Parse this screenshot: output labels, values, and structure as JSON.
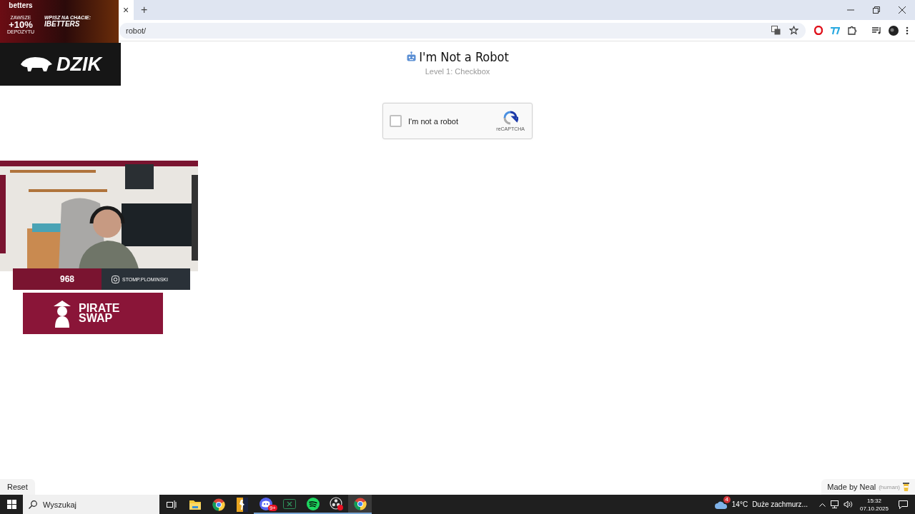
{
  "browser": {
    "tab_close": "×",
    "new_tab": "+",
    "address": "robot/"
  },
  "page": {
    "title": "I'm Not a Robot",
    "subtitle": "Level 1: Checkbox",
    "captcha": {
      "label": "I'm not a robot",
      "checked": false,
      "brand": "reCAPTCHA"
    },
    "reset": "Reset",
    "credit": {
      "text": "Made by Neal",
      "note": "(human)"
    }
  },
  "overlay": {
    "ad": {
      "brand": "betters",
      "promo_top": "ZAWSZE",
      "promo": "+10%",
      "promo_bottom": "DEPOZYTU",
      "prompt": "WPISZ NA CHACIE:",
      "code": "IBETTERS"
    },
    "sponsor": "DZIK",
    "channel_badge": "968",
    "handle": "STOMP.PLOMINSKI",
    "partner": "PIRATE SWAP"
  },
  "taskbar": {
    "search_placeholder": "Wyszukaj",
    "apps": [
      {
        "kind": "folder",
        "running": false,
        "selected": false
      },
      {
        "kind": "chrome",
        "running": false,
        "selected": false
      },
      {
        "kind": "game",
        "running": false,
        "selected": false
      },
      {
        "kind": "discord",
        "running": true,
        "selected": false,
        "badge": "9+"
      },
      {
        "kind": "excel",
        "running": true,
        "selected": false
      },
      {
        "kind": "spotify",
        "running": true,
        "selected": false
      },
      {
        "kind": "obs",
        "running": true,
        "selected": false
      },
      {
        "kind": "chrome",
        "running": true,
        "selected": true
      }
    ],
    "weather": {
      "badge": "4",
      "temperature": "14°C",
      "text": "Duże zachmurz..."
    },
    "time": "15:32",
    "date": "07.10.2025"
  }
}
